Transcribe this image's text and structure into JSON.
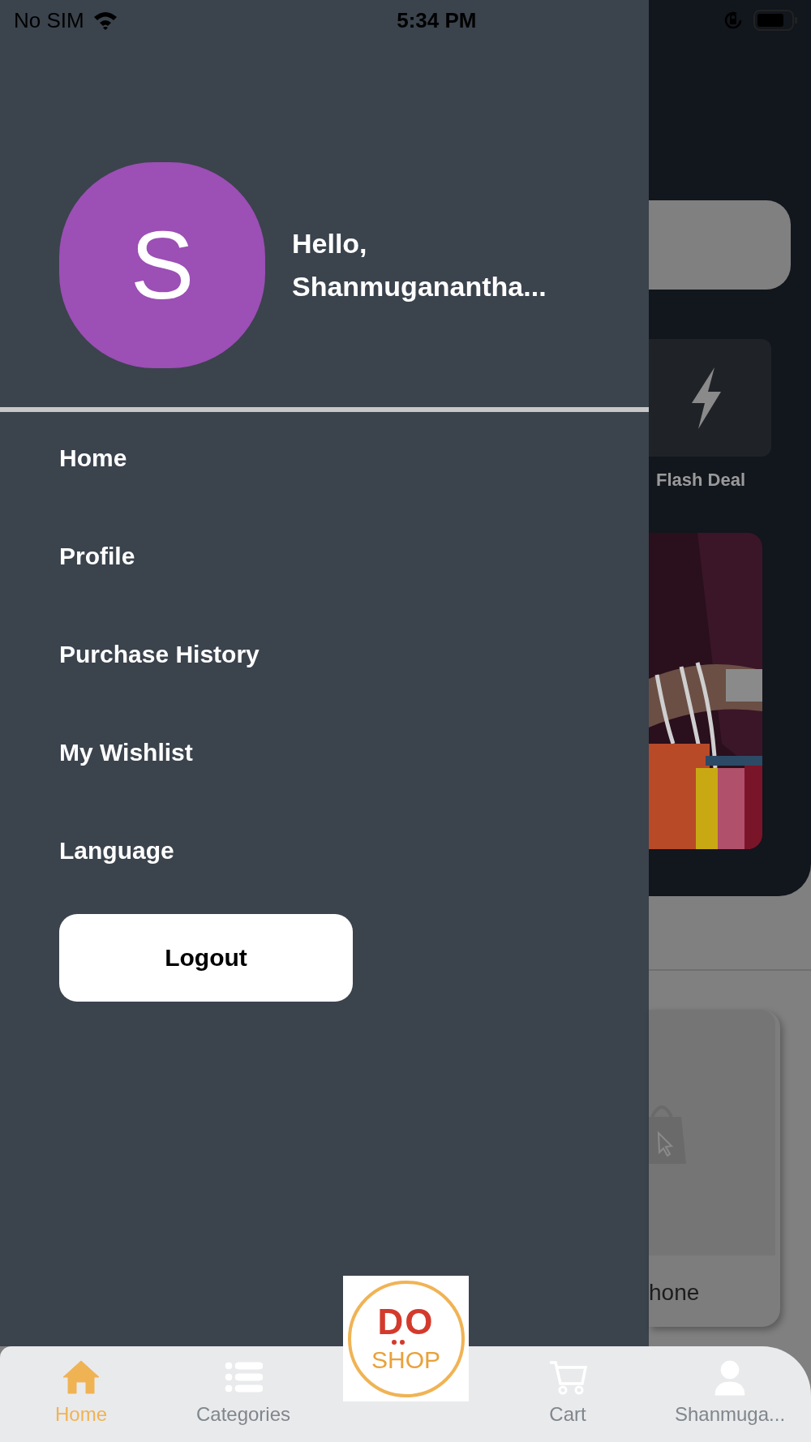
{
  "status_bar": {
    "carrier": "No SIM",
    "time": "5:34 PM"
  },
  "drawer": {
    "avatar_letter": "S",
    "greeting": "Hello,",
    "user_name": "Shanmuganantha...",
    "menu": [
      {
        "label": "Home"
      },
      {
        "label": "Profile"
      },
      {
        "label": "Purchase History"
      },
      {
        "label": "My Wishlist"
      },
      {
        "label": "Language"
      }
    ],
    "logout_button": "Logout"
  },
  "background_page": {
    "flash_deal_label": "Flash Deal",
    "product_name": "hone"
  },
  "logo": {
    "text_top": "DO",
    "text_bottom": "SHOP"
  },
  "bottom_nav": {
    "items": [
      {
        "kind": "home",
        "label": "Home",
        "selected": true
      },
      {
        "kind": "list",
        "label": "Categories",
        "selected": false
      },
      {
        "kind": "cart",
        "label": "Cart",
        "selected": false
      },
      {
        "kind": "person",
        "label": "Shanmuga...",
        "selected": false
      }
    ]
  }
}
